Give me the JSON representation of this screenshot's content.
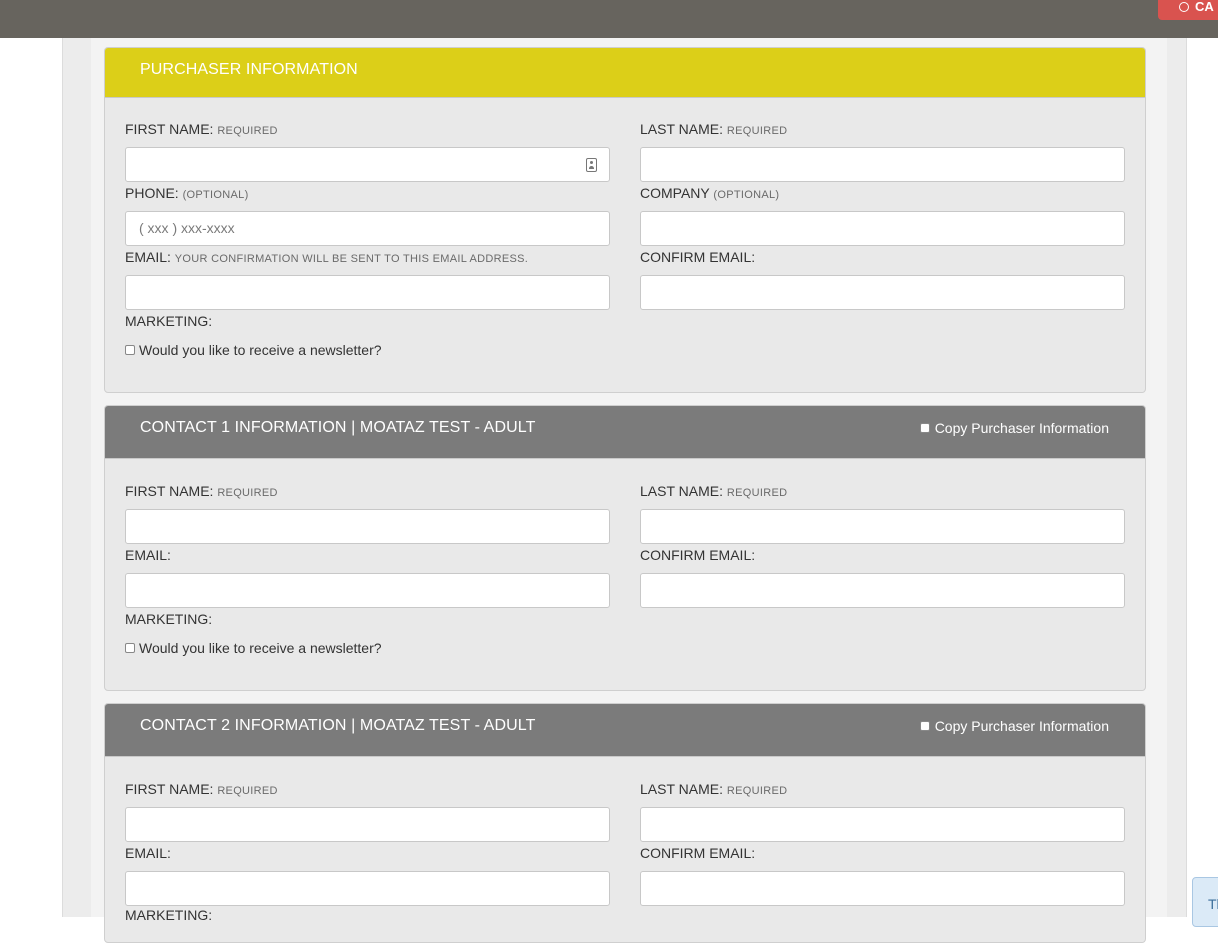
{
  "topbar": {
    "cancel_label": "CA"
  },
  "purchaser": {
    "title": "PURCHASER INFORMATION",
    "first_name_label": "FIRST NAME:",
    "last_name_label": "LAST NAME:",
    "required_hint": "REQUIRED",
    "phone_label": "PHONE:",
    "phone_hint": "(OPTIONAL)",
    "phone_placeholder": "( xxx ) xxx-xxxx",
    "company_label": "COMPANY",
    "company_hint": "(OPTIONAL)",
    "email_label": "EMAIL:",
    "email_hint": "YOUR CONFIRMATION WILL BE SENT TO THIS EMAIL ADDRESS.",
    "confirm_email_label": "CONFIRM EMAIL:",
    "marketing_label": "MARKETING:",
    "newsletter_label": "Would you like to receive a newsletter?"
  },
  "contacts": [
    {
      "title": "CONTACT 1 INFORMATION | MOATAZ TEST - ADULT",
      "copy_label": "Copy Purchaser Information",
      "first_name_label": "FIRST NAME:",
      "last_name_label": "LAST NAME:",
      "required_hint": "REQUIRED",
      "email_label": "EMAIL:",
      "confirm_email_label": "CONFIRM EMAIL:",
      "marketing_label": "MARKETING:",
      "newsletter_label": "Would you like to receive a newsletter?"
    },
    {
      "title": "CONTACT 2 INFORMATION | MOATAZ TEST - ADULT",
      "copy_label": "Copy Purchaser Information",
      "first_name_label": "FIRST NAME:",
      "last_name_label": "LAST NAME:",
      "required_hint": "REQUIRED",
      "email_label": "EMAIL:",
      "confirm_email_label": "CONFIRM EMAIL:",
      "marketing_label": "MARKETING:"
    }
  ],
  "side_tab": {
    "label": "Th"
  },
  "colors": {
    "topbar": "#67645e",
    "purchaser_header": "#dccf18",
    "contact_header": "#7b7b7b",
    "cancel_button": "#d9534f"
  },
  "icons": [
    "cancel-circle-icon",
    "contact-card-icon"
  ]
}
